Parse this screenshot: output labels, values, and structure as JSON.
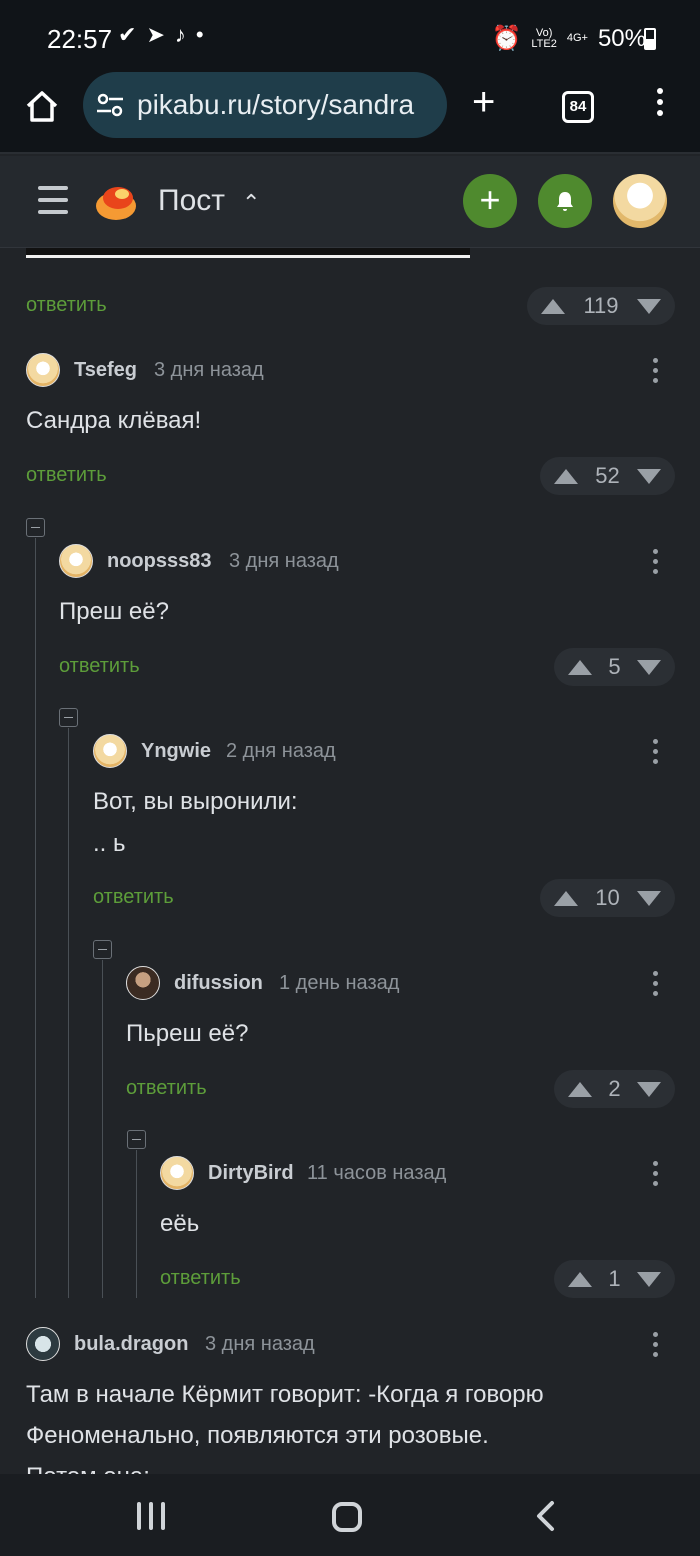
{
  "status_bar": {
    "time": "22:57",
    "battery": "50%",
    "network": "LTE2",
    "network_top": "Vo)",
    "network_right": "4G+"
  },
  "browser": {
    "url": "pikabu.ru/story/sandra",
    "tab_count": "84"
  },
  "header": {
    "title": "Пост"
  },
  "first_reply": {
    "reply_label": "ответить",
    "rating": "119"
  },
  "comments": [
    {
      "author": "Tsefeg",
      "time": "3 дня назад",
      "text": "Сандра клёвая!",
      "reply_label": "ответить",
      "rating": "52"
    },
    {
      "author": "noopsss83",
      "time": "3 дня назад",
      "text": "Преш её?",
      "reply_label": "ответить",
      "rating": "5"
    },
    {
      "author": "Yngwie",
      "time": "2 дня назад",
      "text_line1": "Вот, вы выронили:",
      "text_line2": ".. ь",
      "reply_label": "ответить",
      "rating": "10"
    },
    {
      "author": "difussion",
      "time": "1 день назад",
      "text": "Пьреш её?",
      "reply_label": "ответить",
      "rating": "2"
    },
    {
      "author": "DirtyBird",
      "time": "11 часов назад",
      "text": "еёь",
      "reply_label": "ответить",
      "rating": "1"
    },
    {
      "author": "bula.dragon",
      "time": "3 дня назад",
      "text_line1": "Там в начале Кёрмит говорит: -Когда я говорю",
      "text_line2": "Феноменально, появляются эти розовые.",
      "text_line3": "Потом она:"
    }
  ]
}
